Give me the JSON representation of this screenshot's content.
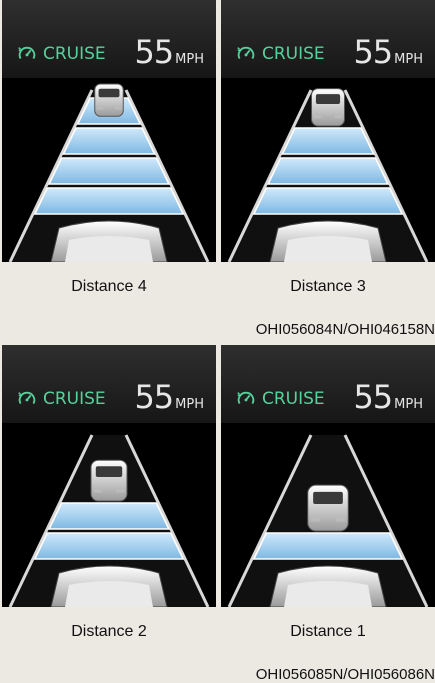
{
  "panels": [
    {
      "cruise_label": "CRUISE",
      "speed": "55",
      "unit": "MPH",
      "caption": "Distance 4",
      "bars": 4
    },
    {
      "cruise_label": "CRUISE",
      "speed": "55",
      "unit": "MPH",
      "caption": "Distance 3",
      "bars": 3
    },
    {
      "cruise_label": "CRUISE",
      "speed": "55",
      "unit": "MPH",
      "caption": "Distance 2",
      "bars": 2
    },
    {
      "cruise_label": "CRUISE",
      "speed": "55",
      "unit": "MPH",
      "caption": "Distance 1",
      "bars": 1
    }
  ],
  "codes": [
    "OHI056084N/OHI046158N",
    "OHI056085N/OHI056086N"
  ],
  "icons": {
    "cruise": "cruise-speedometer-icon"
  },
  "colors": {
    "cruise": "#57d19c",
    "bar": "#9fd0f0",
    "background": "#ece9e3"
  }
}
